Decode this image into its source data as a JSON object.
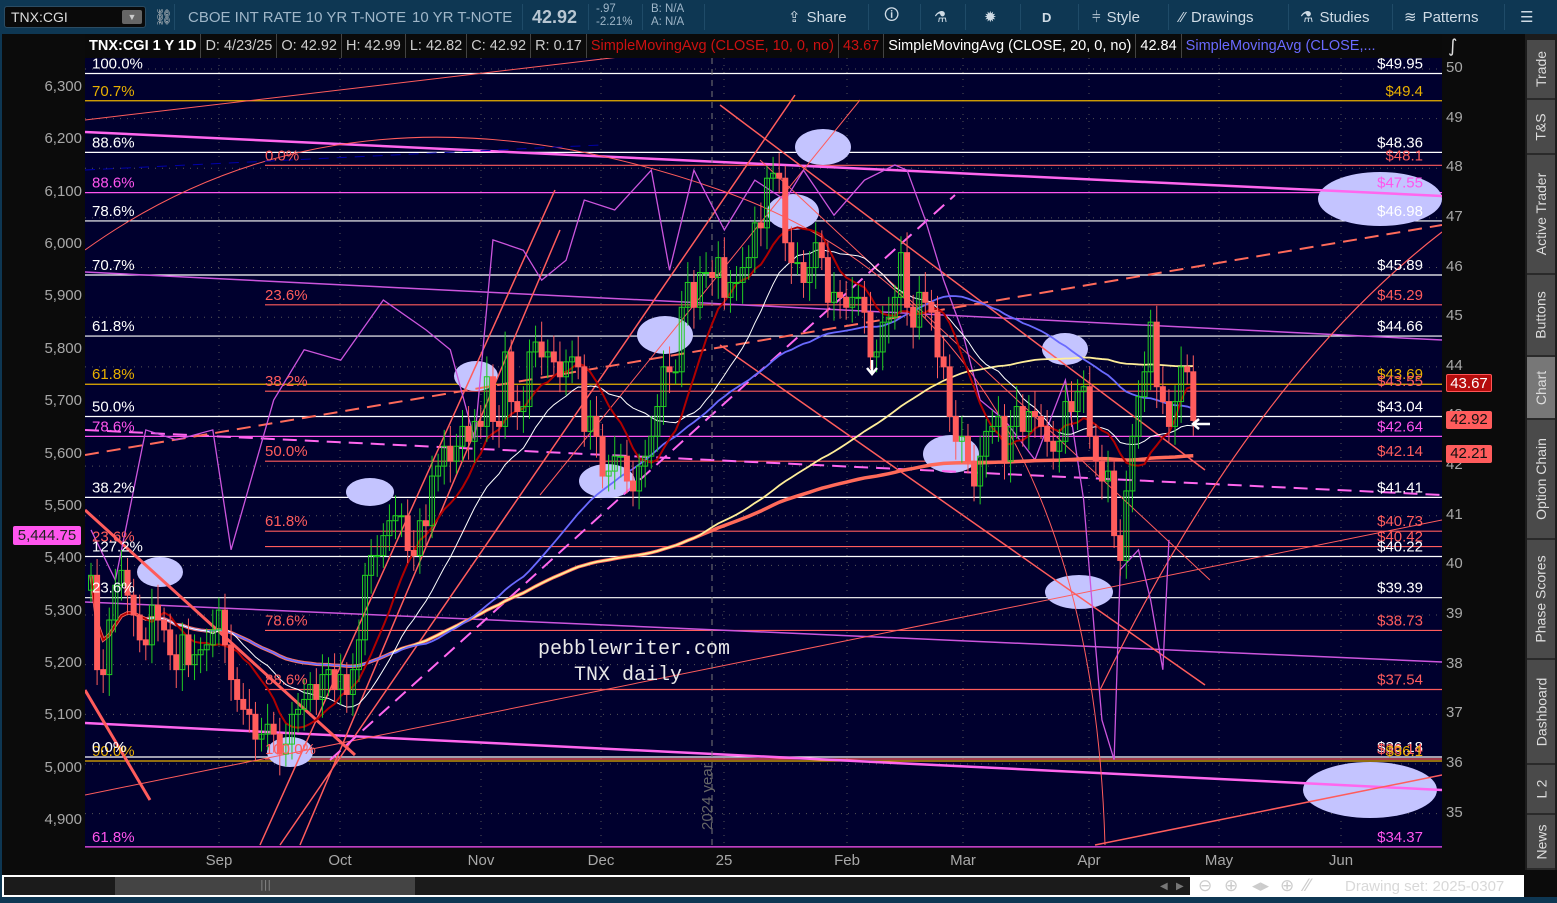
{
  "toolbar": {
    "symbol": "TNX:CGI",
    "description": "CBOE INT RATE 10 YR T-NOTE",
    "short_name": "10 YR T-NOTE",
    "last": "42.92",
    "change": "-.97",
    "change_pct": "-2.21%",
    "bid": "B: N/A",
    "ask": "A: N/A",
    "share": "Share",
    "aggregation": "D",
    "style": "Style",
    "drawings": "Drawings",
    "studies": "Studies",
    "patterns": "Patterns"
  },
  "header": {
    "title": "TNX:CGI 1 Y 1D",
    "date": "D: 4/23/25",
    "open": "O: 42.92",
    "high": "H: 42.99",
    "low": "L: 42.82",
    "close": "C: 42.92",
    "range": "R: 0.17",
    "study1": "SimpleMovingAvg (CLOSE, 10, 0, no)",
    "study1_value": "43.67",
    "study2": "SimpleMovingAvg (CLOSE, 20, 0, no)",
    "study2_value": "42.84",
    "study3": "SimpleMovingAvg (CLOSE,..."
  },
  "colors": {
    "background": "#00002e",
    "up": "#22cc22",
    "down": "#ff5c5c",
    "sma10": "#b00000",
    "sma20": "#ffffff",
    "sma50": "#6a6aff",
    "sma100": "#ffee99",
    "sma200": "#ff6a5a",
    "compare": "#cc55dd",
    "fib_gold": "#e8b000",
    "fib_salmon": "#ff5c5c",
    "fib_magenta": "#ff55ee",
    "fib_white": "#ffffff"
  },
  "right_axis": [
    "50",
    "49",
    "48",
    "47",
    "46",
    "45",
    "44",
    "43",
    "42",
    "41",
    "40",
    "39",
    "38",
    "37",
    "36",
    "35"
  ],
  "left_axis": [
    "6,300",
    "6,200",
    "6,100",
    "6,000",
    "5,900",
    "5,800",
    "5,700",
    "5,600",
    "5,500",
    "5,400",
    "5,300",
    "5,200",
    "5,100",
    "5,000",
    "4,900"
  ],
  "x_axis": [
    "Sep",
    "Oct",
    "Nov",
    "Dec",
    "25",
    "Feb",
    "Mar",
    "Apr",
    "May",
    "Jun"
  ],
  "price_tags": {
    "sma10": "43.67",
    "last": "42.92",
    "other": "42.21",
    "compare_last": "5,444.75"
  },
  "price_levels": [
    {
      "label": "$49.95",
      "value": 49.95,
      "color": "#ffffff"
    },
    {
      "label": "$49.4",
      "value": 49.4,
      "color": "#e8b000"
    },
    {
      "label": "$48.36",
      "value": 48.36,
      "color": "#ffffff"
    },
    {
      "label": "$48.1",
      "value": 48.1,
      "color": "#ff5c5c"
    },
    {
      "label": "$47.55",
      "value": 47.55,
      "color": "#ff55ee"
    },
    {
      "label": "$46.98",
      "value": 46.98,
      "color": "#ffffff"
    },
    {
      "label": "$45.89",
      "value": 45.89,
      "color": "#ffffff"
    },
    {
      "label": "$45.29",
      "value": 45.29,
      "color": "#ff5c5c"
    },
    {
      "label": "$44.66",
      "value": 44.66,
      "color": "#ffffff"
    },
    {
      "label": "$43.69",
      "value": 43.69,
      "color": "#e8b000"
    },
    {
      "label": "$43.55",
      "value": 43.55,
      "color": "#ff5c5c"
    },
    {
      "label": "$43.04",
      "value": 43.04,
      "color": "#ffffff"
    },
    {
      "label": "$42.64",
      "value": 42.64,
      "color": "#ff55ee"
    },
    {
      "label": "$42.14",
      "value": 42.14,
      "color": "#ff5c5c"
    },
    {
      "label": "$41.41",
      "value": 41.41,
      "color": "#ffffff"
    },
    {
      "label": "$40.73",
      "value": 40.73,
      "color": "#ff5c5c"
    },
    {
      "label": "$40.42",
      "value": 40.42,
      "color": "#ff5c5c"
    },
    {
      "label": "$40.22",
      "value": 40.22,
      "color": "#ffffff"
    },
    {
      "label": "$39.39",
      "value": 39.39,
      "color": "#ffffff"
    },
    {
      "label": "$38.73",
      "value": 38.73,
      "color": "#ff5c5c"
    },
    {
      "label": "$37.54",
      "value": 37.54,
      "color": "#ff5c5c"
    },
    {
      "label": "$36.18",
      "value": 36.18,
      "color": "#ffffff"
    },
    {
      "label": "$36.14",
      "value": 36.14,
      "color": "#ff5c5c"
    },
    {
      "label": "$36.1",
      "value": 36.1,
      "color": "#e8b000"
    },
    {
      "label": "$34.37",
      "value": 34.37,
      "color": "#ff55ee"
    }
  ],
  "fib_left_labels": [
    {
      "label": "100.0%",
      "value": 49.95,
      "color": "#ffffff"
    },
    {
      "label": "70.7%",
      "value": 49.4,
      "color": "#e8b000"
    },
    {
      "label": "88.6%",
      "value": 48.36,
      "color": "#ffffff"
    },
    {
      "label": "88.6%",
      "value": 47.55,
      "color": "#ff55ee"
    },
    {
      "label": "78.6%",
      "value": 46.98,
      "color": "#ffffff"
    },
    {
      "label": "70.7%",
      "value": 45.89,
      "color": "#ffffff"
    },
    {
      "label": "61.8%",
      "value": 44.66,
      "color": "#ffffff"
    },
    {
      "label": "61.8%",
      "value": 43.69,
      "color": "#e8b000"
    },
    {
      "label": "50.0%",
      "value": 43.04,
      "color": "#ffffff"
    },
    {
      "label": "78.6%",
      "value": 42.64,
      "color": "#ff55ee"
    },
    {
      "label": "38.2%",
      "value": 41.41,
      "color": "#ffffff"
    },
    {
      "label": "23.6%",
      "value": 40.42,
      "color": "#ff5c5c"
    },
    {
      "label": "127.2%",
      "value": 40.22,
      "color": "#ffffff"
    },
    {
      "label": "23.6%",
      "value": 39.39,
      "color": "#ffffff"
    },
    {
      "label": "90.0%",
      "value": 36.1,
      "color": "#e8b000"
    },
    {
      "label": "0.0%",
      "value": 36.18,
      "color": "#ffffff"
    },
    {
      "label": "61.8%",
      "value": 34.37,
      "color": "#ff55ee"
    }
  ],
  "fib_mid_labels": [
    {
      "label": "0.0%",
      "value": 48.1
    },
    {
      "label": "23.6%",
      "value": 45.29
    },
    {
      "label": "38.2%",
      "value": 43.55
    },
    {
      "label": "50.0%",
      "value": 42.14
    },
    {
      "label": "61.8%",
      "value": 40.73
    },
    {
      "label": "78.6%",
      "value": 38.73
    },
    {
      "label": "88.6%",
      "value": 37.54
    },
    {
      "label": "100.0%",
      "value": 36.14
    }
  ],
  "watermark": {
    "line1": "pebblewriter.com",
    "line2": "TNX daily"
  },
  "year_marker": "2024 year",
  "chart_data": {
    "type": "candlestick",
    "symbol": "TNX:CGI",
    "period": "1 Y 1D",
    "y_right_range": [
      34.3,
      50.2
    ],
    "y_left_range": [
      4840,
      6340
    ],
    "closes": [
      39.8,
      37.9,
      37.8,
      38.9,
      39.6,
      39.9,
      39.4,
      39.0,
      38.5,
      38.4,
      39.2,
      38.9,
      38.7,
      38.2,
      37.9,
      38.6,
      38.0,
      38.2,
      38.3,
      38.4,
      38.7,
      39.1,
      38.4,
      37.7,
      37.3,
      37.1,
      37.0,
      36.5,
      36.6,
      36.8,
      36.6,
      36.2,
      36.4,
      37.0,
      37.1,
      37.3,
      37.6,
      37.3,
      37.8,
      37.9,
      37.5,
      37.8,
      37.4,
      37.9,
      38.5,
      39.8,
      40.2,
      40.2,
      40.6,
      40.9,
      41.0,
      41.0,
      40.3,
      40.2,
      40.9,
      40.8,
      41.8,
      42.0,
      42.4,
      42.1,
      42.4,
      42.8,
      42.5,
      42.9,
      42.8,
      43.8,
      42.9,
      42.8,
      44.3,
      43.3,
      43.1,
      43.2,
      44.3,
      44.5,
      44.2,
      44.3,
      44.1,
      43.8,
      44.1,
      44.2,
      44.0,
      42.7,
      43.0,
      42.6,
      41.8,
      41.9,
      42.2,
      42.2,
      41.7,
      41.5,
      42.0,
      42.2,
      42.6,
      43.2,
      44.0,
      43.9,
      43.9,
      45.2,
      45.7,
      45.2,
      45.9,
      45.9,
      45.8,
      46.2,
      45.4,
      45.7,
      45.7,
      46.0,
      46.2,
      46.9,
      46.8,
      47.8,
      47.9,
      47.8,
      46.5,
      46.1,
      46.1,
      45.7,
      46.0,
      46.5,
      46.2,
      45.3,
      45.5,
      45.4,
      45.2,
      45.4,
      45.4,
      45.1,
      44.2,
      44.3,
      44.9,
      45.0,
      45.4,
      46.3,
      45.2,
      44.8,
      45.5,
      45.3,
      45.1,
      44.2,
      44.0,
      43.0,
      42.5,
      42.6,
      42.1,
      41.6,
      42.2,
      42.7,
      42.8,
      43.0,
      42.1,
      42.8,
      43.2,
      42.7,
      43.1,
      43.0,
      42.8,
      42.5,
      42.3,
      42.5,
      43.3,
      43.1,
      43.5,
      43.6,
      42.6,
      42.1,
      41.7,
      41.9,
      40.6,
      40.1,
      41.5,
      42.6,
      43.4,
      43.9,
      44.9,
      43.6,
      43.3,
      42.8,
      43.3,
      44.0,
      43.9,
      42.92
    ],
    "compare_series_points": [
      [
        0,
        5456
      ],
      [
        4,
        5360
      ],
      [
        9,
        5647
      ],
      [
        14,
        5628
      ],
      [
        20,
        5647
      ],
      [
        23,
        5418
      ],
      [
        30,
        5704
      ],
      [
        35,
        5800
      ],
      [
        41,
        5780
      ],
      [
        48,
        5895
      ],
      [
        55,
        5838
      ],
      [
        59,
        5800
      ],
      [
        63,
        5628
      ],
      [
        66,
        6010
      ],
      [
        71,
        5990
      ],
      [
        74,
        5933
      ],
      [
        78,
        5971
      ],
      [
        81,
        6086
      ],
      [
        86,
        6067
      ],
      [
        92,
        6143
      ],
      [
        95,
        5952
      ],
      [
        99,
        6143
      ],
      [
        104,
        6029
      ],
      [
        109,
        6124
      ],
      [
        114,
        6086
      ],
      [
        117,
        6143
      ],
      [
        122,
        6057
      ],
      [
        127,
        6124
      ],
      [
        132,
        6153
      ],
      [
        134,
        6143
      ],
      [
        137,
        6048
      ],
      [
        140,
        5933
      ],
      [
        143,
        5838
      ],
      [
        146,
        5704
      ],
      [
        150,
        5666
      ],
      [
        155,
        5590
      ],
      [
        160,
        5742
      ],
      [
        163,
        5513
      ],
      [
        165,
        5227
      ],
      [
        166,
        5093
      ],
      [
        168,
        5017
      ],
      [
        169,
        5380
      ],
      [
        172,
        5418
      ],
      [
        174,
        5322
      ],
      [
        176,
        5189
      ],
      [
        177,
        5437
      ]
    ],
    "studies": [
      "SMA 10",
      "SMA 20",
      "SMA 50",
      "SMA 100",
      "SMA 200"
    ]
  },
  "sidebar": {
    "tabs": [
      "Trade",
      "T&S",
      "Active Trader",
      "Buttons",
      "Chart",
      "Option Chain",
      "Phase Scores",
      "Dashboard",
      "L 2",
      "News"
    ],
    "active": "Chart"
  },
  "footer": {
    "drawing_set": "Drawing set: 2025-0307"
  }
}
